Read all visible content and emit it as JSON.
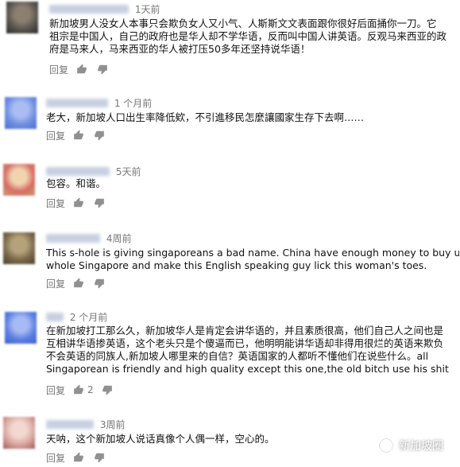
{
  "comments": [
    {
      "time": "1天前",
      "lines": [
        "新加坡男人没女人本事只会欺负女人又小气、人斯斯文文表面跟你很好后面捅你一刀。它",
        "祖宗是中国人，自己的政府也是华人却不学华语，反而叫中国人讲英语。反观马来西亚的政",
        "府是马来人，马来西亚的华人被打压50多年还坚持说华语！"
      ],
      "reply_label": "回复",
      "avatar_colors": [
        "#5a5550",
        "#8c7f70",
        "#2e2a26"
      ]
    },
    {
      "time": "1 个月前",
      "lines": [
        "老大，新加坡人口出生率降低欸，不引進移民怎麼讓國家生存下去啊……"
      ],
      "reply_label": "回复",
      "avatar_colors": [
        "#6f8ee0",
        "#a9bdf2",
        "#4c6dd4"
      ]
    },
    {
      "time": "5天前",
      "lines": [
        "包容。和谐。"
      ],
      "reply_label": "回复",
      "avatar_colors": [
        "#d66c66",
        "#f0d4b0",
        "#c8a070"
      ]
    },
    {
      "time": "4周前",
      "lines": [
        "This s-hole is giving singaporeans a bad name. China have enough money to buy up the",
        "whole Singapore and make this English speaking guy lick this woman's toes."
      ],
      "reply_label": "回复",
      "avatar_colors": [
        "#7a6a4c",
        "#b6a27a",
        "#4a3e2a"
      ]
    },
    {
      "time": "2 个月前",
      "lines": [
        "在新加坡打工那么久，新加坡华人是肯定会讲华语的，并且素质很高，他们自己人之间也是",
        "互相讲华语掺英语，这个老头只是个傻逼而已，他明明能讲华语却非得用很烂的英语来欺负",
        "不会英语的同族人,新加坡人哪里来的自信？英语国家的人都听不懂他们在说些什么。all",
        "Singaporean is friendly and high quality except this one,the old bitch  use his shit"
      ],
      "reply_label": "回复",
      "like_count": "2",
      "avatar_colors": [
        "#5c7fe2",
        "#a6baf3",
        "#3d5fcf"
      ]
    },
    {
      "time": "3周前",
      "lines": [
        "天呐，这个新加坡人说话真像个人偶一样，空心的。"
      ],
      "reply_label": "回复",
      "avatar_colors": [
        "#d9a7a0",
        "#f2d8cf",
        "#a05a54"
      ]
    }
  ],
  "watermark": {
    "text": "新加坡圈",
    "icon": "wechat-channel-icon"
  },
  "icons": {
    "like": "thumbs-up-icon",
    "dislike": "thumbs-down-icon"
  },
  "colors": {
    "meta_text": "#767676",
    "body_text": "#111111",
    "background": "#ffffff"
  }
}
